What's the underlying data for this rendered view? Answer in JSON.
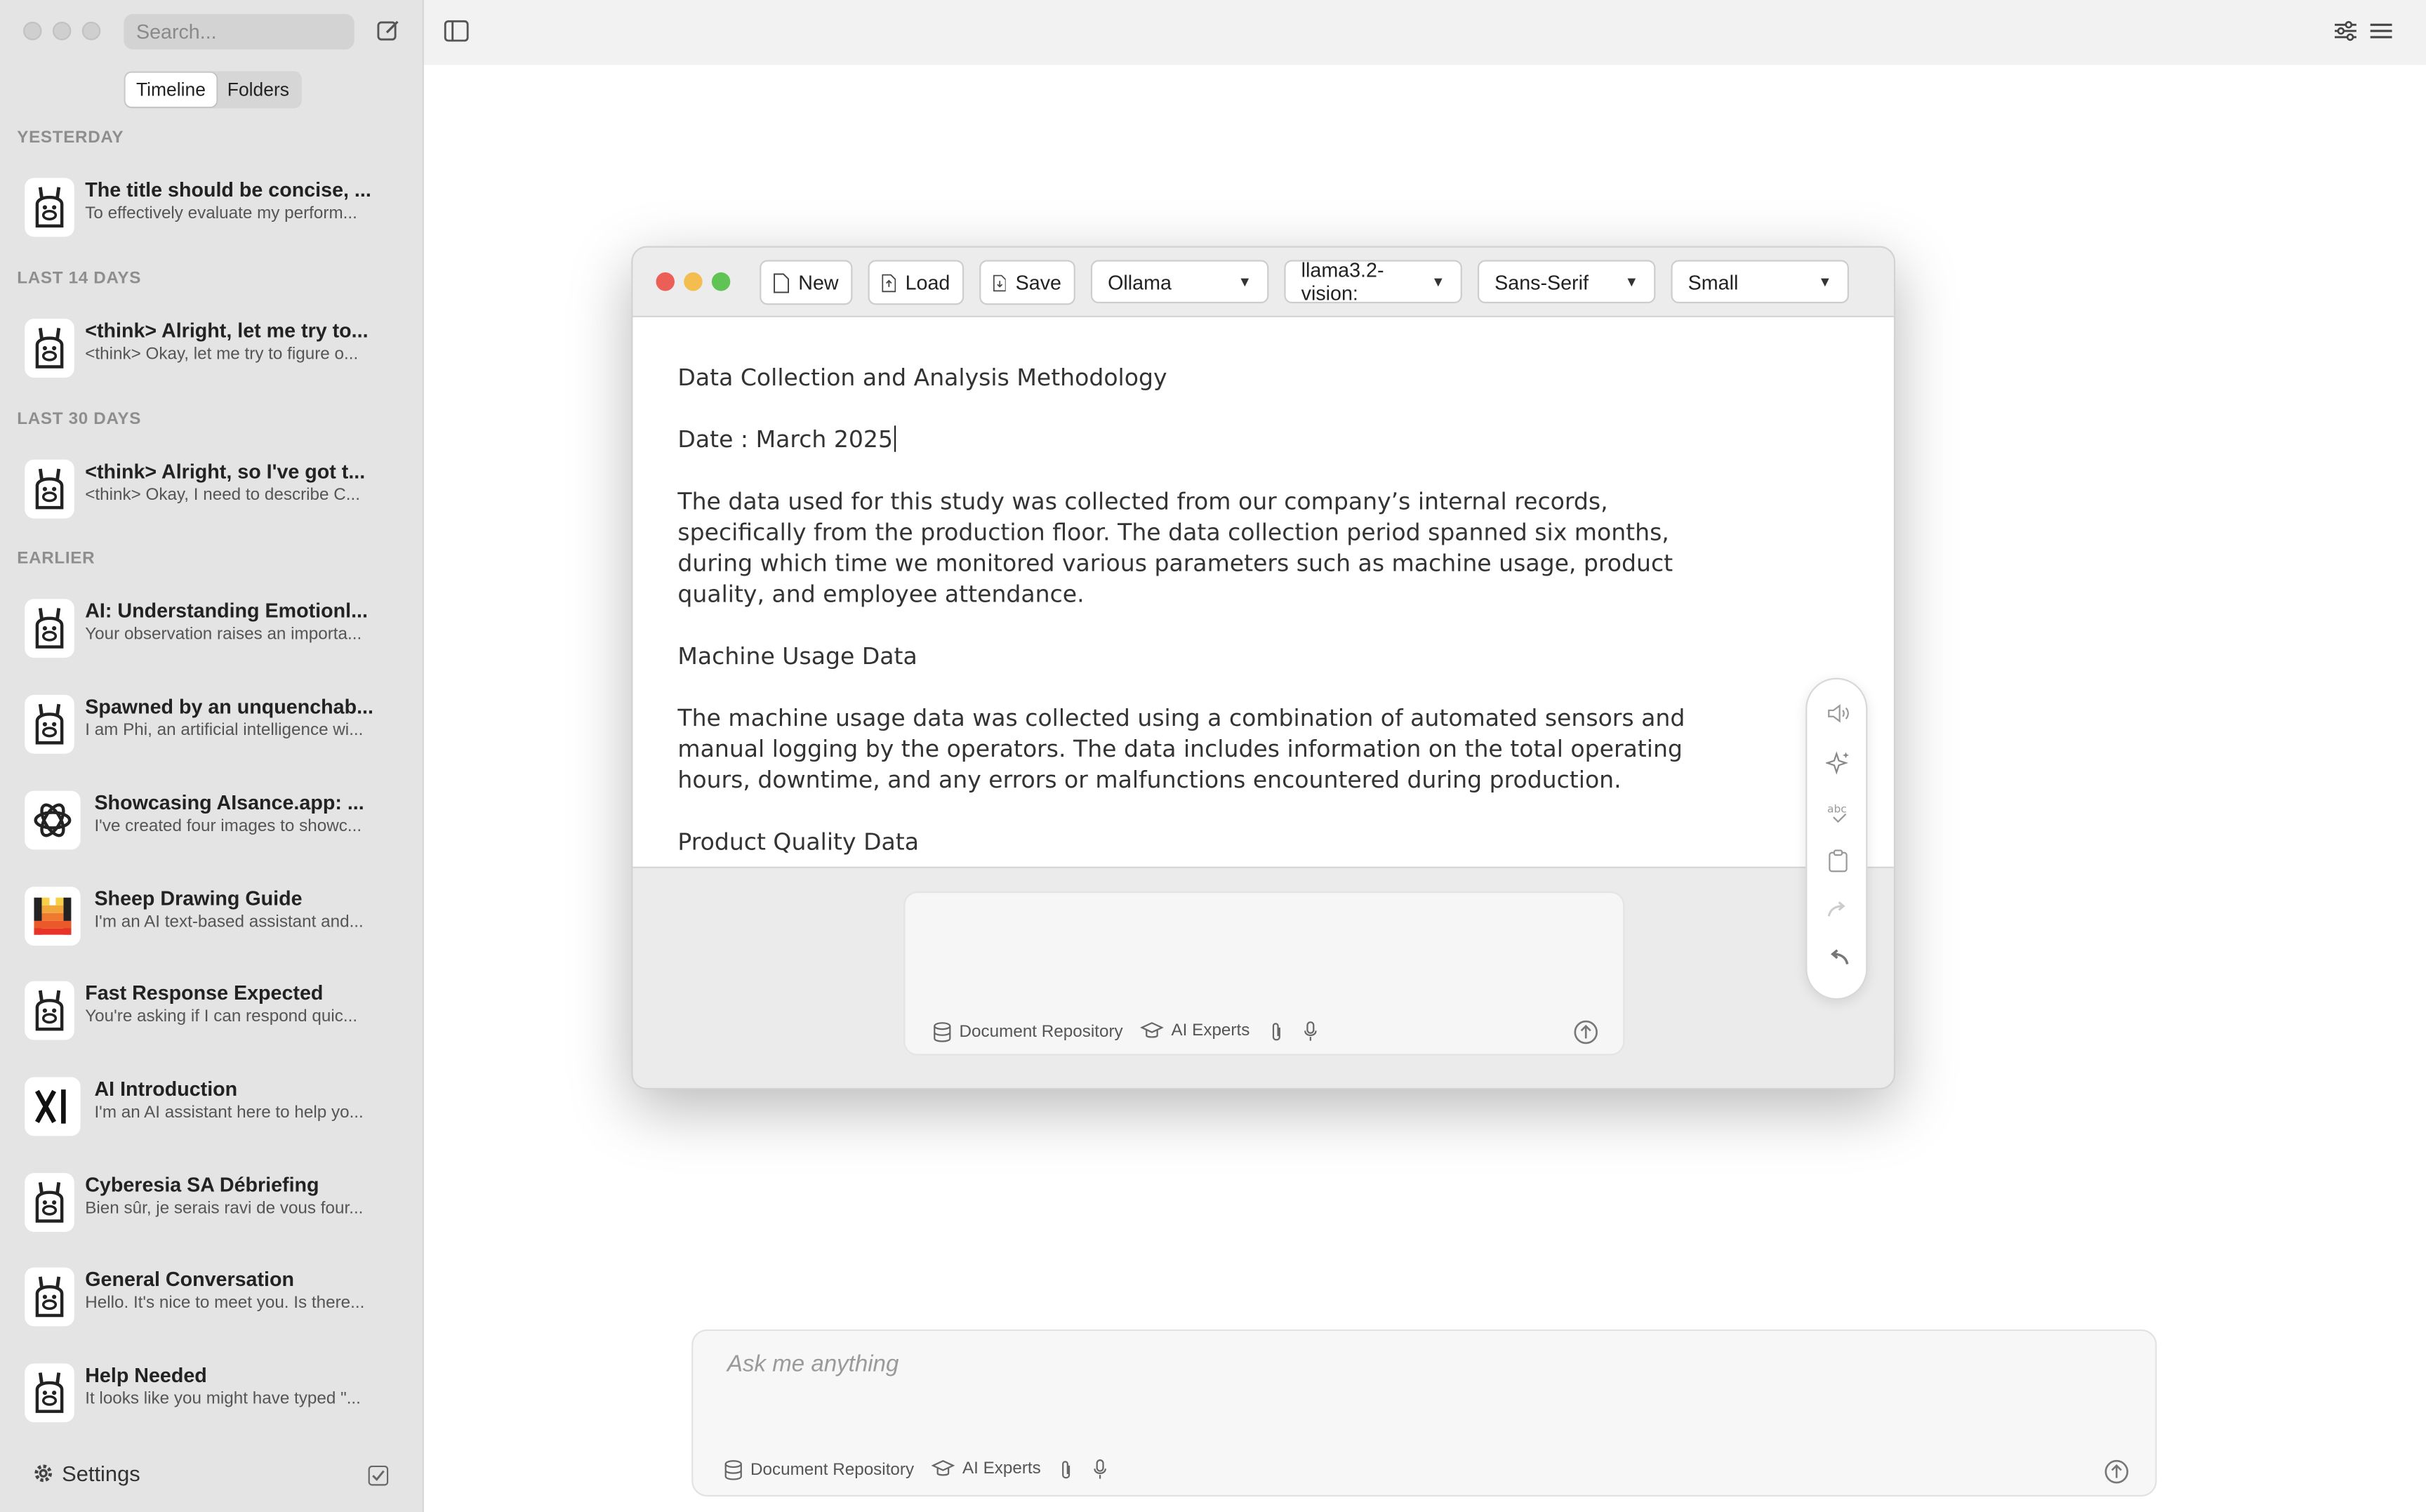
{
  "sidebar": {
    "search_placeholder": "Search...",
    "tabs": [
      "Timeline",
      "Folders"
    ],
    "groups": [
      {
        "label": "YESTERDAY"
      },
      {
        "label": "LAST 14 DAYS"
      },
      {
        "label": "LAST 30 DAYS"
      },
      {
        "label": "EARLIER"
      }
    ],
    "conversations": [
      {
        "title": "The title should be concise, ...",
        "snippet": "To effectively evaluate my perform...",
        "icon": "llama-icon"
      },
      {
        "title": "<think> Alright, let me try to...",
        "snippet": "<think> Okay, let me try to figure o...",
        "icon": "llama-icon"
      },
      {
        "title": "<think> Alright, so I've got t...",
        "snippet": "<think> Okay, I need to describe C...",
        "icon": "llama-icon"
      },
      {
        "title": "AI: Understanding Emotionl...",
        "snippet": "Your observation raises an importa...",
        "icon": "llama-icon"
      },
      {
        "title": "Spawned by an unquenchab...",
        "snippet": "I am Phi, an artificial intelligence wi...",
        "icon": "llama-icon"
      },
      {
        "title": "Showcasing AIsance.app: ...",
        "snippet": "I've created four images to showc...",
        "icon": "openai-icon"
      },
      {
        "title": "Sheep Drawing Guide",
        "snippet": "I'm an AI text-based assistant and...",
        "icon": "mistral-icon"
      },
      {
        "title": "Fast Response Expected",
        "snippet": "You're asking if I can respond quic...",
        "icon": "llama-icon"
      },
      {
        "title": "AI Introduction",
        "snippet": "I'm an AI assistant here to help yo...",
        "icon": "xai-icon"
      },
      {
        "title": "Cyberesia SA Débriefing",
        "snippet": "Bien sûr, je serais ravi de vous four...",
        "icon": "llama-icon"
      },
      {
        "title": "General Conversation",
        "snippet": "Hello. It's nice to meet you. Is there...",
        "icon": "llama-icon"
      },
      {
        "title": "Help Needed",
        "snippet": "It looks like you might have typed \"...",
        "icon": "llama-icon"
      }
    ],
    "settings_label": "Settings"
  },
  "prompt": {
    "placeholder": "Ask me anything",
    "doc_repo": "Document Repository",
    "ai_experts": "AI Experts"
  },
  "editor": {
    "buttons": {
      "new": "New",
      "load": "Load",
      "save": "Save"
    },
    "selects": {
      "provider": "Ollama",
      "model": "llama3.2-vision:",
      "font": "Sans-Serif",
      "size": "Small"
    },
    "doc": {
      "heading": "Data Collection and Analysis Methodology",
      "date": "Date : March 2025",
      "para1": "The data used for this study was collected from our company’s internal records, specifically from the production floor. The data collection period spanned six months, during which time we monitored various parameters such as machine usage, product quality, and employee attendance.",
      "h2": "Machine Usage Data",
      "para2": "The machine usage data was collected using a combination of automated sensors and manual logging by the operators. The data includes information on the total operating hours, downtime, and any errors or malfunctions encountered during production.",
      "h3": "Product Quality Data"
    },
    "inner_prompt": {
      "doc_repo": "Document Repository",
      "ai_experts": "AI Experts"
    }
  },
  "colors": {
    "close": "#ec5f57",
    "minimize": "#f4bd4f",
    "zoom": "#5fc454"
  }
}
